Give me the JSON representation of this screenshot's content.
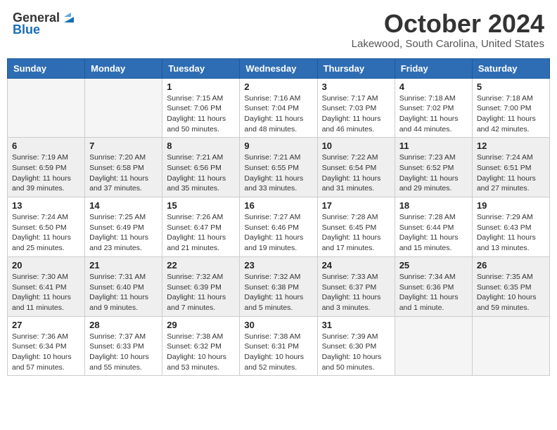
{
  "header": {
    "logo_general": "General",
    "logo_blue": "Blue",
    "month_title": "October 2024",
    "location": "Lakewood, South Carolina, United States"
  },
  "days_of_week": [
    "Sunday",
    "Monday",
    "Tuesday",
    "Wednesday",
    "Thursday",
    "Friday",
    "Saturday"
  ],
  "weeks": [
    [
      {
        "day": "",
        "empty": true
      },
      {
        "day": "",
        "empty": true
      },
      {
        "day": "1",
        "sunrise": "Sunrise: 7:15 AM",
        "sunset": "Sunset: 7:06 PM",
        "daylight": "Daylight: 11 hours and 50 minutes."
      },
      {
        "day": "2",
        "sunrise": "Sunrise: 7:16 AM",
        "sunset": "Sunset: 7:04 PM",
        "daylight": "Daylight: 11 hours and 48 minutes."
      },
      {
        "day": "3",
        "sunrise": "Sunrise: 7:17 AM",
        "sunset": "Sunset: 7:03 PM",
        "daylight": "Daylight: 11 hours and 46 minutes."
      },
      {
        "day": "4",
        "sunrise": "Sunrise: 7:18 AM",
        "sunset": "Sunset: 7:02 PM",
        "daylight": "Daylight: 11 hours and 44 minutes."
      },
      {
        "day": "5",
        "sunrise": "Sunrise: 7:18 AM",
        "sunset": "Sunset: 7:00 PM",
        "daylight": "Daylight: 11 hours and 42 minutes."
      }
    ],
    [
      {
        "day": "6",
        "sunrise": "Sunrise: 7:19 AM",
        "sunset": "Sunset: 6:59 PM",
        "daylight": "Daylight: 11 hours and 39 minutes."
      },
      {
        "day": "7",
        "sunrise": "Sunrise: 7:20 AM",
        "sunset": "Sunset: 6:58 PM",
        "daylight": "Daylight: 11 hours and 37 minutes."
      },
      {
        "day": "8",
        "sunrise": "Sunrise: 7:21 AM",
        "sunset": "Sunset: 6:56 PM",
        "daylight": "Daylight: 11 hours and 35 minutes."
      },
      {
        "day": "9",
        "sunrise": "Sunrise: 7:21 AM",
        "sunset": "Sunset: 6:55 PM",
        "daylight": "Daylight: 11 hours and 33 minutes."
      },
      {
        "day": "10",
        "sunrise": "Sunrise: 7:22 AM",
        "sunset": "Sunset: 6:54 PM",
        "daylight": "Daylight: 11 hours and 31 minutes."
      },
      {
        "day": "11",
        "sunrise": "Sunrise: 7:23 AM",
        "sunset": "Sunset: 6:52 PM",
        "daylight": "Daylight: 11 hours and 29 minutes."
      },
      {
        "day": "12",
        "sunrise": "Sunrise: 7:24 AM",
        "sunset": "Sunset: 6:51 PM",
        "daylight": "Daylight: 11 hours and 27 minutes."
      }
    ],
    [
      {
        "day": "13",
        "sunrise": "Sunrise: 7:24 AM",
        "sunset": "Sunset: 6:50 PM",
        "daylight": "Daylight: 11 hours and 25 minutes."
      },
      {
        "day": "14",
        "sunrise": "Sunrise: 7:25 AM",
        "sunset": "Sunset: 6:49 PM",
        "daylight": "Daylight: 11 hours and 23 minutes."
      },
      {
        "day": "15",
        "sunrise": "Sunrise: 7:26 AM",
        "sunset": "Sunset: 6:47 PM",
        "daylight": "Daylight: 11 hours and 21 minutes."
      },
      {
        "day": "16",
        "sunrise": "Sunrise: 7:27 AM",
        "sunset": "Sunset: 6:46 PM",
        "daylight": "Daylight: 11 hours and 19 minutes."
      },
      {
        "day": "17",
        "sunrise": "Sunrise: 7:28 AM",
        "sunset": "Sunset: 6:45 PM",
        "daylight": "Daylight: 11 hours and 17 minutes."
      },
      {
        "day": "18",
        "sunrise": "Sunrise: 7:28 AM",
        "sunset": "Sunset: 6:44 PM",
        "daylight": "Daylight: 11 hours and 15 minutes."
      },
      {
        "day": "19",
        "sunrise": "Sunrise: 7:29 AM",
        "sunset": "Sunset: 6:43 PM",
        "daylight": "Daylight: 11 hours and 13 minutes."
      }
    ],
    [
      {
        "day": "20",
        "sunrise": "Sunrise: 7:30 AM",
        "sunset": "Sunset: 6:41 PM",
        "daylight": "Daylight: 11 hours and 11 minutes."
      },
      {
        "day": "21",
        "sunrise": "Sunrise: 7:31 AM",
        "sunset": "Sunset: 6:40 PM",
        "daylight": "Daylight: 11 hours and 9 minutes."
      },
      {
        "day": "22",
        "sunrise": "Sunrise: 7:32 AM",
        "sunset": "Sunset: 6:39 PM",
        "daylight": "Daylight: 11 hours and 7 minutes."
      },
      {
        "day": "23",
        "sunrise": "Sunrise: 7:32 AM",
        "sunset": "Sunset: 6:38 PM",
        "daylight": "Daylight: 11 hours and 5 minutes."
      },
      {
        "day": "24",
        "sunrise": "Sunrise: 7:33 AM",
        "sunset": "Sunset: 6:37 PM",
        "daylight": "Daylight: 11 hours and 3 minutes."
      },
      {
        "day": "25",
        "sunrise": "Sunrise: 7:34 AM",
        "sunset": "Sunset: 6:36 PM",
        "daylight": "Daylight: 11 hours and 1 minute."
      },
      {
        "day": "26",
        "sunrise": "Sunrise: 7:35 AM",
        "sunset": "Sunset: 6:35 PM",
        "daylight": "Daylight: 10 hours and 59 minutes."
      }
    ],
    [
      {
        "day": "27",
        "sunrise": "Sunrise: 7:36 AM",
        "sunset": "Sunset: 6:34 PM",
        "daylight": "Daylight: 10 hours and 57 minutes."
      },
      {
        "day": "28",
        "sunrise": "Sunrise: 7:37 AM",
        "sunset": "Sunset: 6:33 PM",
        "daylight": "Daylight: 10 hours and 55 minutes."
      },
      {
        "day": "29",
        "sunrise": "Sunrise: 7:38 AM",
        "sunset": "Sunset: 6:32 PM",
        "daylight": "Daylight: 10 hours and 53 minutes."
      },
      {
        "day": "30",
        "sunrise": "Sunrise: 7:38 AM",
        "sunset": "Sunset: 6:31 PM",
        "daylight": "Daylight: 10 hours and 52 minutes."
      },
      {
        "day": "31",
        "sunrise": "Sunrise: 7:39 AM",
        "sunset": "Sunset: 6:30 PM",
        "daylight": "Daylight: 10 hours and 50 minutes."
      },
      {
        "day": "",
        "empty": true
      },
      {
        "day": "",
        "empty": true
      }
    ]
  ]
}
